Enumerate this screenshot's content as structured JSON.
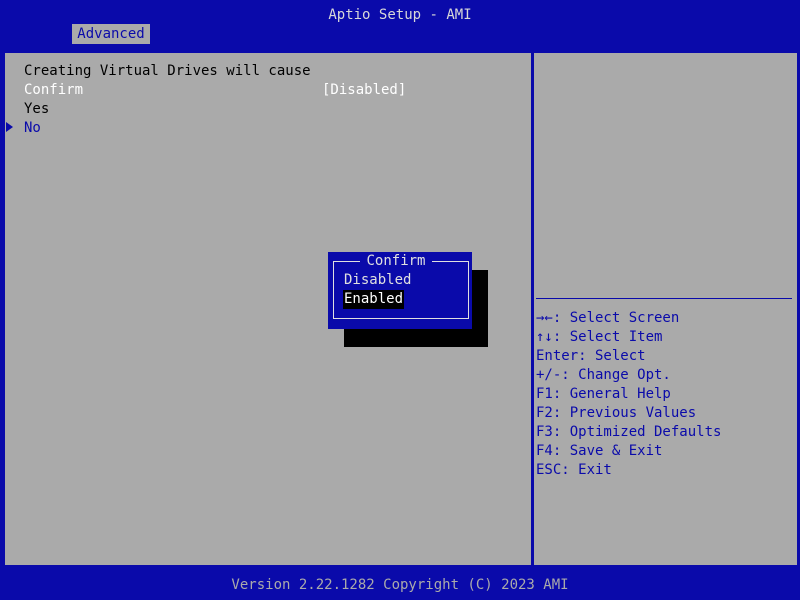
{
  "window": {
    "title": "Aptio Setup - AMI"
  },
  "tabs": [
    {
      "label": "Advanced",
      "active": true
    }
  ],
  "main": {
    "description": "Creating Virtual Drives will cause",
    "setting": {
      "label": "Confirm",
      "value": "[Disabled]"
    },
    "options": [
      {
        "label": "Yes"
      },
      {
        "label": "No",
        "selected": true
      }
    ]
  },
  "popup": {
    "title": "Confirm",
    "options": [
      {
        "label": "Disabled"
      },
      {
        "label": "Enabled",
        "highlighted": true
      }
    ]
  },
  "help": {
    "keys": [
      "→←: Select Screen",
      "↑↓: Select Item",
      "Enter: Select",
      "+/-: Change Opt.",
      "F1: General Help",
      "F2: Previous Values",
      "F3: Optimized Defaults",
      "F4: Save & Exit",
      "ESC: Exit"
    ]
  },
  "footer": {
    "version": "Version 2.22.1282 Copyright (C) 2023 AMI"
  },
  "colors": {
    "background_blue": "#0A0AAA",
    "panel_gray": "#AAAAAA",
    "text_white": "#FFFFFF",
    "highlight_bg": "#000000"
  }
}
